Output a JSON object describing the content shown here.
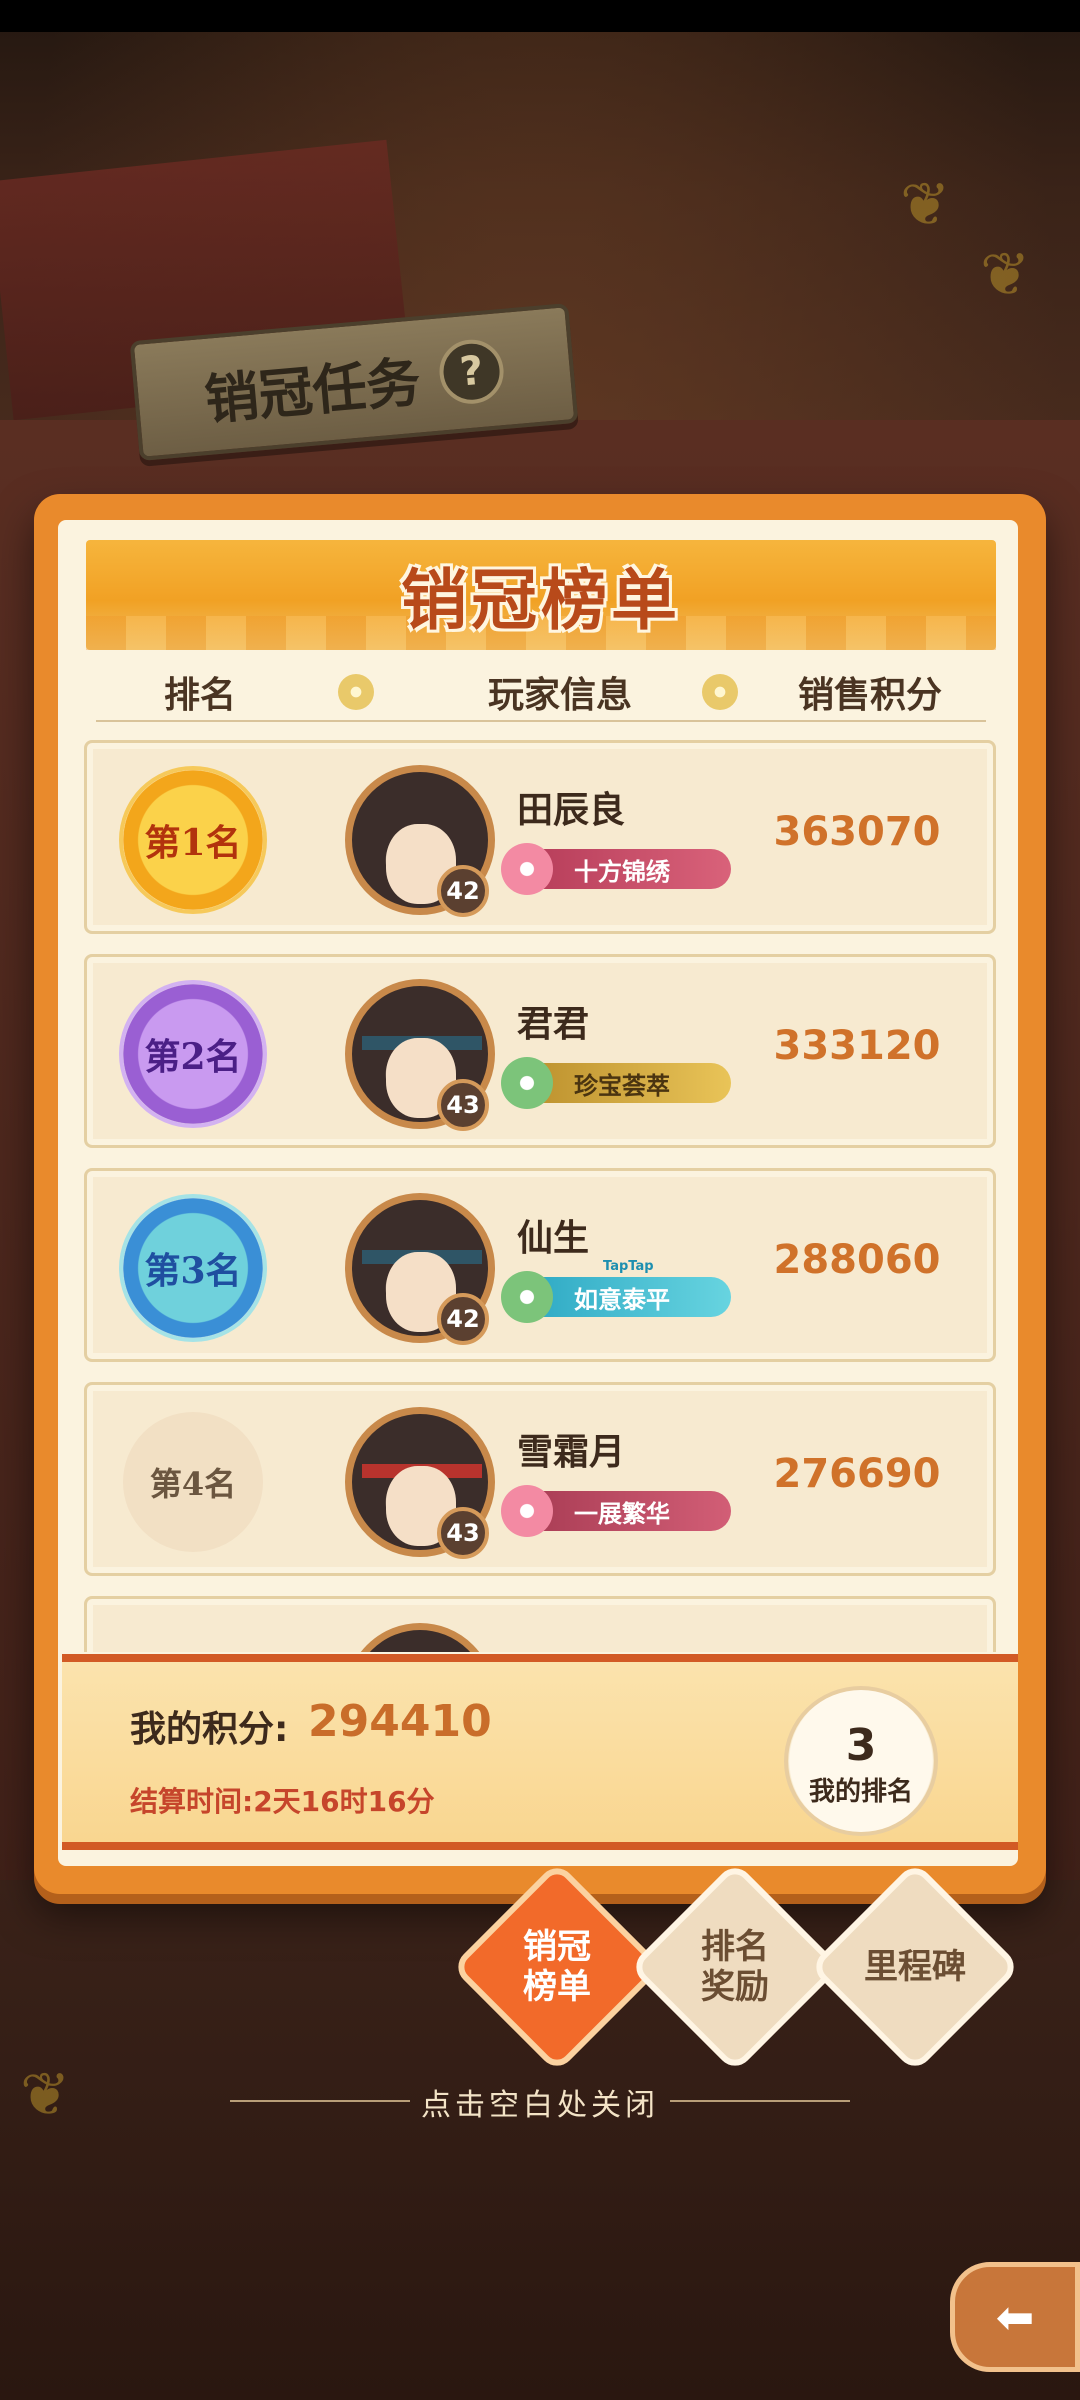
{
  "quest": {
    "title": "销冠任务",
    "help_icon": "?"
  },
  "board": {
    "title": "销冠榜单",
    "headers": {
      "rank": "排名",
      "player": "玩家信息",
      "score": "销售积分"
    },
    "rows": [
      {
        "rank_label": "第1名",
        "name": "田辰良",
        "level": "42",
        "title_tag": "十方锦绣",
        "score": "363070"
      },
      {
        "rank_label": "第2名",
        "name": "君君",
        "level": "43",
        "title_tag": "珍宝荟萃",
        "score": "333120"
      },
      {
        "rank_label": "第3名",
        "name": "仙生",
        "level": "42",
        "title_tag": "如意泰平",
        "tag_brand": "TapTap",
        "score": "288060"
      },
      {
        "rank_label": "第4名",
        "name": "雪霜月",
        "level": "43",
        "title_tag": "一展繁华",
        "score": "276690"
      }
    ]
  },
  "summary": {
    "my_score_label": "我的积分:",
    "my_score_value": "294410",
    "settle_time": "结算时间:2天16时16分",
    "my_rank_number": "3",
    "my_rank_label": "我的排名"
  },
  "tabs": {
    "board": "销冠\n榜单",
    "reward": "排名\n奖励",
    "milestone": "里程碑"
  },
  "close_hint": "点击空白处关闭",
  "colors": {
    "panel_orange": "#e98a2c",
    "score_orange": "#d0722a",
    "active_tab": "#f26a2a",
    "settle_red": "#c6452b"
  }
}
